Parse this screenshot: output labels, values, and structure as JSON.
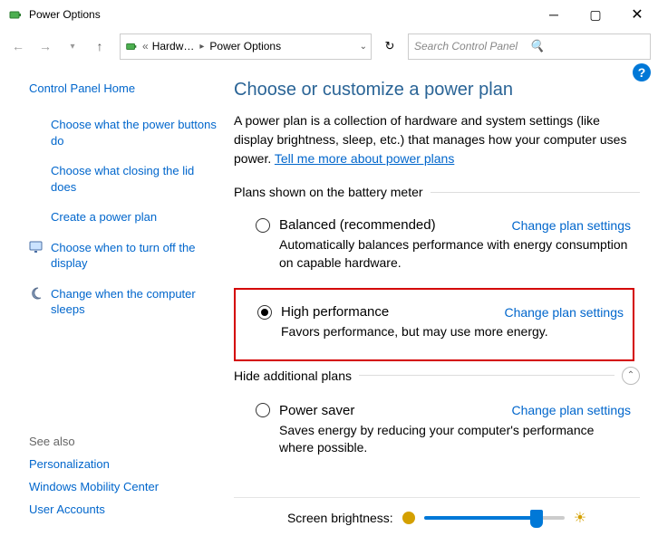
{
  "window": {
    "title": "Power Options"
  },
  "breadcrumb": {
    "b1": "Hardw…",
    "b2": "Power Options"
  },
  "search": {
    "placeholder": "Search Control Panel"
  },
  "sidebar": {
    "home": "Control Panel Home",
    "items": [
      "Choose what the power buttons do",
      "Choose what closing the lid does",
      "Create a power plan",
      "Choose when to turn off the display",
      "Change when the computer sleeps"
    ],
    "see_also_label": "See also",
    "see_also": [
      "Personalization",
      "Windows Mobility Center",
      "User Accounts"
    ]
  },
  "content": {
    "heading": "Choose or customize a power plan",
    "intro_a": "A power plan is a collection of hardware and system settings (like display brightness, sleep, etc.) that manages how your computer uses power. ",
    "intro_link": "Tell me more about power plans",
    "group1_label": "Plans shown on the battery meter",
    "group2_label": "Hide additional plans",
    "change_label": "Change plan settings",
    "plans": [
      {
        "name": "Balanced (recommended)",
        "desc": "Automatically balances performance with energy consumption on capable hardware.",
        "selected": false
      },
      {
        "name": "High performance",
        "desc": "Favors performance, but may use more energy.",
        "selected": true
      },
      {
        "name": "Power saver",
        "desc": "Saves energy by reducing your computer's performance where possible.",
        "selected": false
      }
    ],
    "brightness_label": "Screen brightness:"
  }
}
